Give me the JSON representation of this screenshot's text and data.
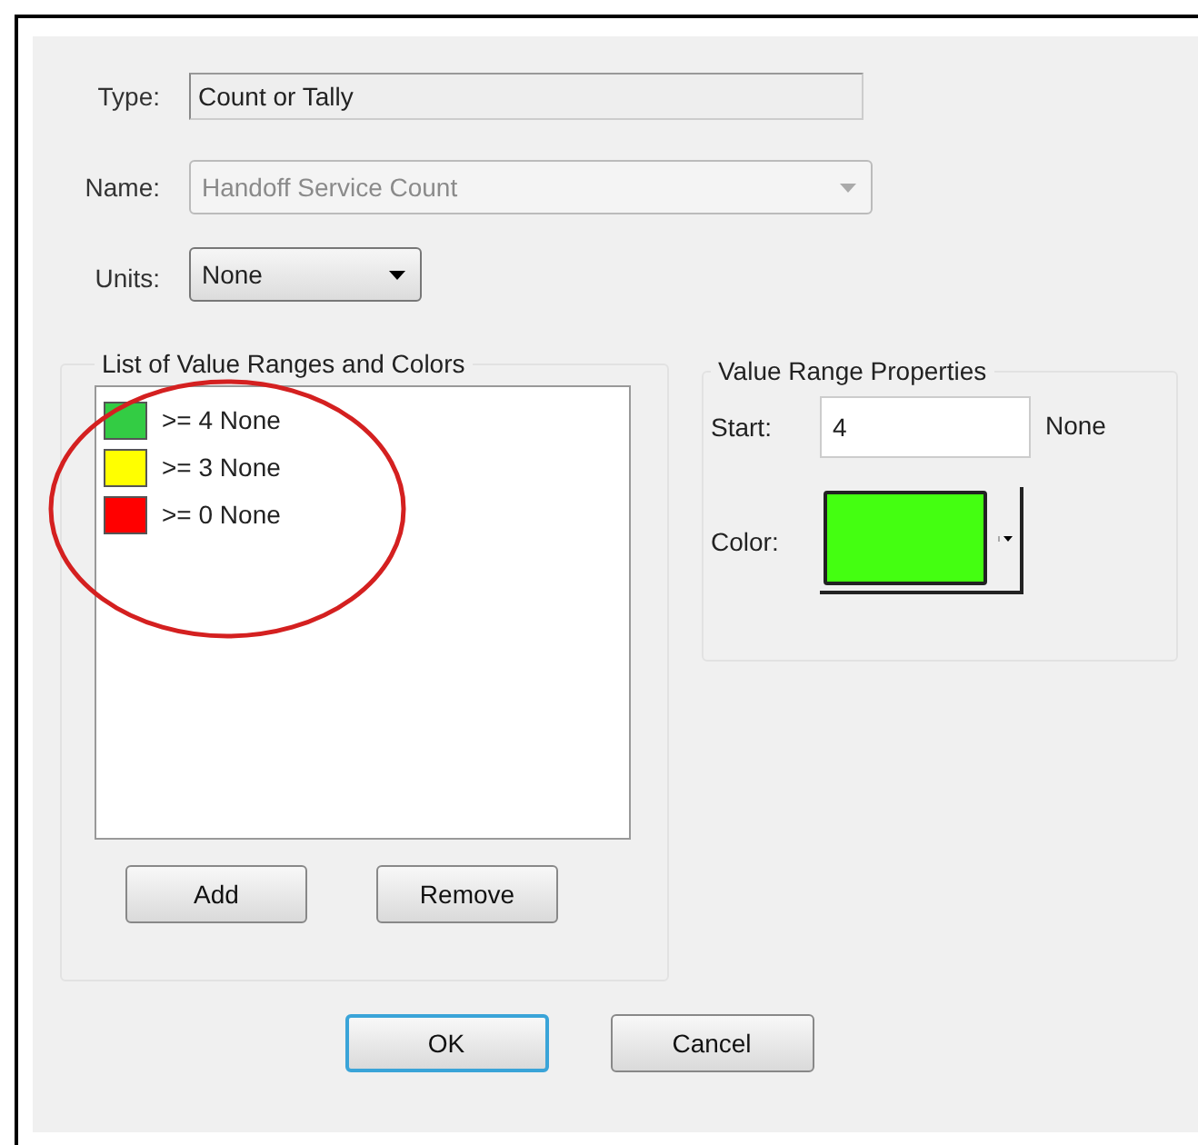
{
  "fields": [
    {
      "kind": "readonly",
      "label": "Type:",
      "value": "Count or Tally",
      "disabled": false
    },
    {
      "kind": "combo",
      "label": "Name:",
      "value": "Handoff Service Count",
      "disabled": true
    },
    {
      "kind": "dropdown",
      "label": "Units:",
      "value": "None",
      "disabled": false
    }
  ],
  "ranges_group": {
    "title": "List of Value Ranges and Colors",
    "items": [
      {
        "label": ">= 4 None",
        "color": "#33cc44"
      },
      {
        "label": ">= 3 None",
        "color": "#ffff00"
      },
      {
        "label": ">= 0 None",
        "color": "#ff0000"
      }
    ],
    "buttons": [
      "Add",
      "Remove"
    ]
  },
  "properties_group": {
    "title": "Value Range Properties",
    "start_label": "Start:",
    "start_value": "4",
    "start_unit": "None",
    "color_label": "Color:",
    "color": "#44ff11"
  },
  "buttons": [
    {
      "label": "OK",
      "default": true
    },
    {
      "label": "Cancel",
      "default": false
    }
  ],
  "annotation": {
    "kind": "ellipse"
  }
}
